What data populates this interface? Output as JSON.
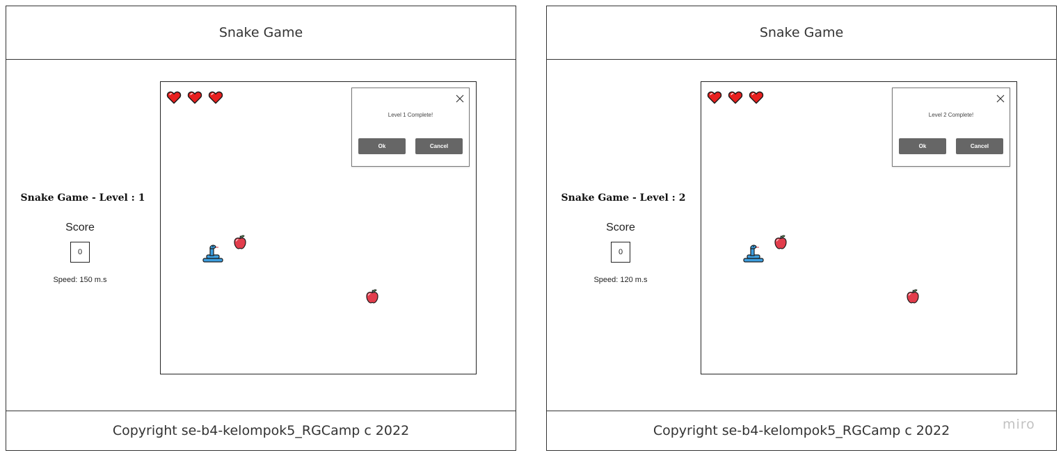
{
  "screens": [
    {
      "header_title": "Snake Game",
      "level_title": "Snake Game - Level : 1",
      "score_label": "Score",
      "score_value": "0",
      "speed_text": "Speed: 150 m.s",
      "lives": 3,
      "dialog": {
        "message": "Level 1 Complete!",
        "ok_label": "Ok",
        "cancel_label": "Cancel",
        "close_icon": "close-icon"
      },
      "footer_text": "Copyright se-b4-kelompok5_RGCamp c 2022"
    },
    {
      "header_title": "Snake Game",
      "level_title": "Snake Game - Level : 2",
      "score_label": "Score",
      "score_value": "0",
      "speed_text": "Speed: 120 m.s",
      "lives": 3,
      "dialog": {
        "message": "Level 2 Complete!",
        "ok_label": "Ok",
        "cancel_label": "Cancel",
        "close_icon": "close-icon"
      },
      "footer_text": "Copyright se-b4-kelompok5_RGCamp c 2022"
    }
  ],
  "icons": {
    "life": "heart-icon",
    "player": "snake-icon",
    "food": "apple-icon"
  },
  "colors": {
    "heart": "#e8201f",
    "snake": "#3d9fe0",
    "apple": "#e23d4c",
    "button": "#666666"
  },
  "watermark": "miro"
}
